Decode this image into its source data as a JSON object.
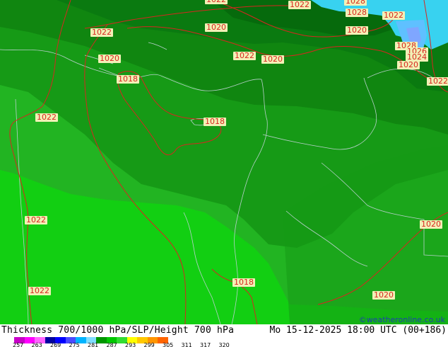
{
  "map": {
    "isobar_labels": [
      "1022",
      "1022",
      "1028",
      "1028",
      "1022",
      "1020",
      "1020",
      "1022",
      "1020",
      "1028",
      "1026",
      "1024",
      "1020",
      "1022",
      "1020",
      "1018",
      "1018",
      "1022",
      "1022",
      "1022",
      "1020",
      "1018",
      "1020"
    ],
    "colors": {
      "sea_cyan": "#38d2f0",
      "land_green_1": "#0a7a10",
      "land_green_2": "#169a16",
      "land_green_3": "#22b422",
      "land_green_4": "#12cf12",
      "land_green_5": "#1fc41f",
      "isobar": "#d8261f",
      "border": "#b8c8c8"
    }
  },
  "footer": {
    "title": "Thickness 700/1000 hPa/SLP/Height 700 hPa",
    "valid_time": "Mo 15-12-2025 18:00 UTC (00+186)",
    "credit": "©weatheronline.co.uk",
    "scale_ticks": [
      "257",
      "263",
      "269",
      "275",
      "281",
      "287",
      "293",
      "299",
      "305",
      "311",
      "317",
      "320"
    ],
    "scale_colors": [
      "#c800c8",
      "#ff00ff",
      "#ff64ff",
      "#0000a0",
      "#0000ff",
      "#4b4bff",
      "#00b4ff",
      "#80dcff",
      "#009600",
      "#00c800",
      "#32dc32",
      "#ffff00",
      "#ffc800",
      "#ff9600",
      "#ff6400"
    ]
  }
}
